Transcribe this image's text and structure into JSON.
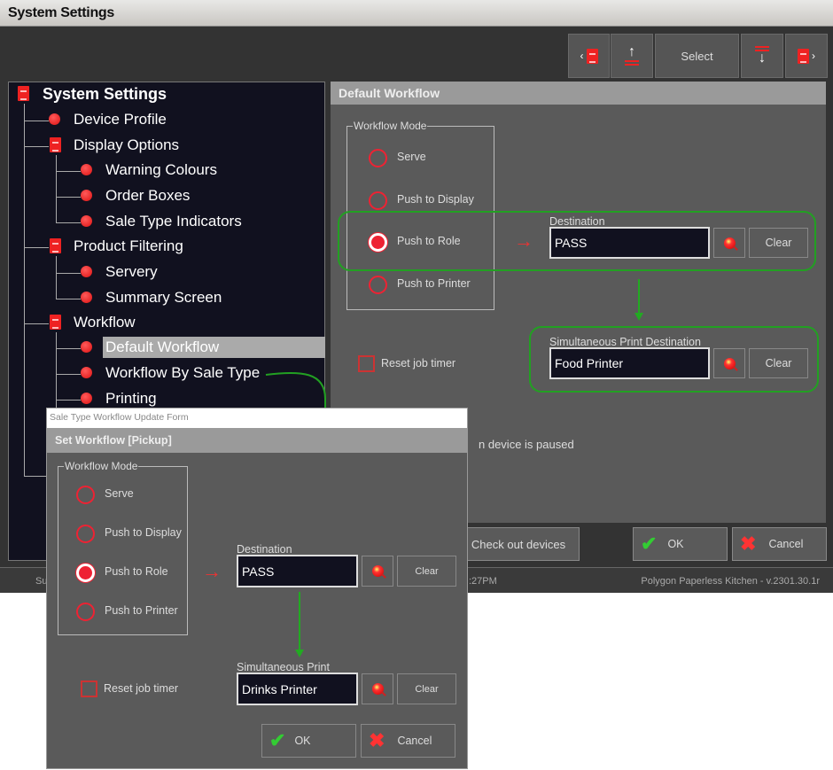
{
  "window": {
    "title": "System Settings"
  },
  "toolbar": {
    "select_label": "Select",
    "icons": [
      "prev-document-icon",
      "move-up-icon",
      "move-down-icon",
      "next-document-icon"
    ]
  },
  "tree": {
    "items": [
      {
        "label": "System Settings",
        "level": 0,
        "icon": "document-icon"
      },
      {
        "label": "Device Profile",
        "level": 1,
        "icon": "dot-icon"
      },
      {
        "label": "Display Options",
        "level": 1,
        "icon": "document-icon"
      },
      {
        "label": "Warning Colours",
        "level": 2,
        "icon": "dot-icon"
      },
      {
        "label": "Order Boxes",
        "level": 2,
        "icon": "dot-icon"
      },
      {
        "label": "Sale Type Indicators",
        "level": 2,
        "icon": "dot-icon"
      },
      {
        "label": "Product Filtering",
        "level": 1,
        "icon": "document-icon"
      },
      {
        "label": "Servery",
        "level": 2,
        "icon": "dot-icon"
      },
      {
        "label": "Summary Screen",
        "level": 2,
        "icon": "dot-icon"
      },
      {
        "label": "Workflow",
        "level": 1,
        "icon": "document-icon"
      },
      {
        "label": "Default Workflow",
        "level": 2,
        "icon": "dot-icon",
        "selected": true
      },
      {
        "label": "Workflow By Sale Type",
        "level": 2,
        "icon": "dot-icon"
      },
      {
        "label": "Printing",
        "level": 2,
        "icon": "dot-icon"
      }
    ]
  },
  "main": {
    "header": "Default Workflow",
    "workflow_mode": {
      "legend": "Workflow Mode",
      "options": [
        "Serve",
        "Push to Display",
        "Push to Role",
        "Push to Printer"
      ],
      "selected": "Push to Role"
    },
    "destination": {
      "label": "Destination",
      "value": "PASS",
      "clear": "Clear"
    },
    "simultaneous": {
      "label": "Simultaneous Print Destination",
      "value": "Food Printer",
      "clear": "Clear"
    },
    "reset_job_timer": {
      "label": "Reset job timer",
      "checked": false
    },
    "paused_fragment": "n device is paused",
    "check_out_devices": "Check out devices",
    "ok": "OK",
    "cancel": "Cancel"
  },
  "status": {
    "left_fragment": "Su",
    "time_fragment": ":27PM",
    "version": "Polygon Paperless Kitchen - v.2301.30.1r"
  },
  "dialog": {
    "title": "Sale Type Workflow Update Form",
    "header": "Set Workflow  [Pickup]",
    "workflow_mode": {
      "legend": "Workflow Mode",
      "options": [
        "Serve",
        "Push to Display",
        "Push to Role",
        "Push to Printer"
      ],
      "selected": "Push to Role"
    },
    "destination": {
      "label": "Destination",
      "value": "PASS",
      "clear": "Clear"
    },
    "simultaneous": {
      "label": "Simultaneous Print",
      "value": "Drinks Printer",
      "clear": "Clear"
    },
    "reset_job_timer": {
      "label": "Reset job timer",
      "checked": false
    },
    "ok": "OK",
    "cancel": "Cancel"
  },
  "colors": {
    "accent": "#e22222",
    "annotation": "#22a022",
    "panel": "#5a5a5a",
    "tree_bg": "#11111f"
  }
}
